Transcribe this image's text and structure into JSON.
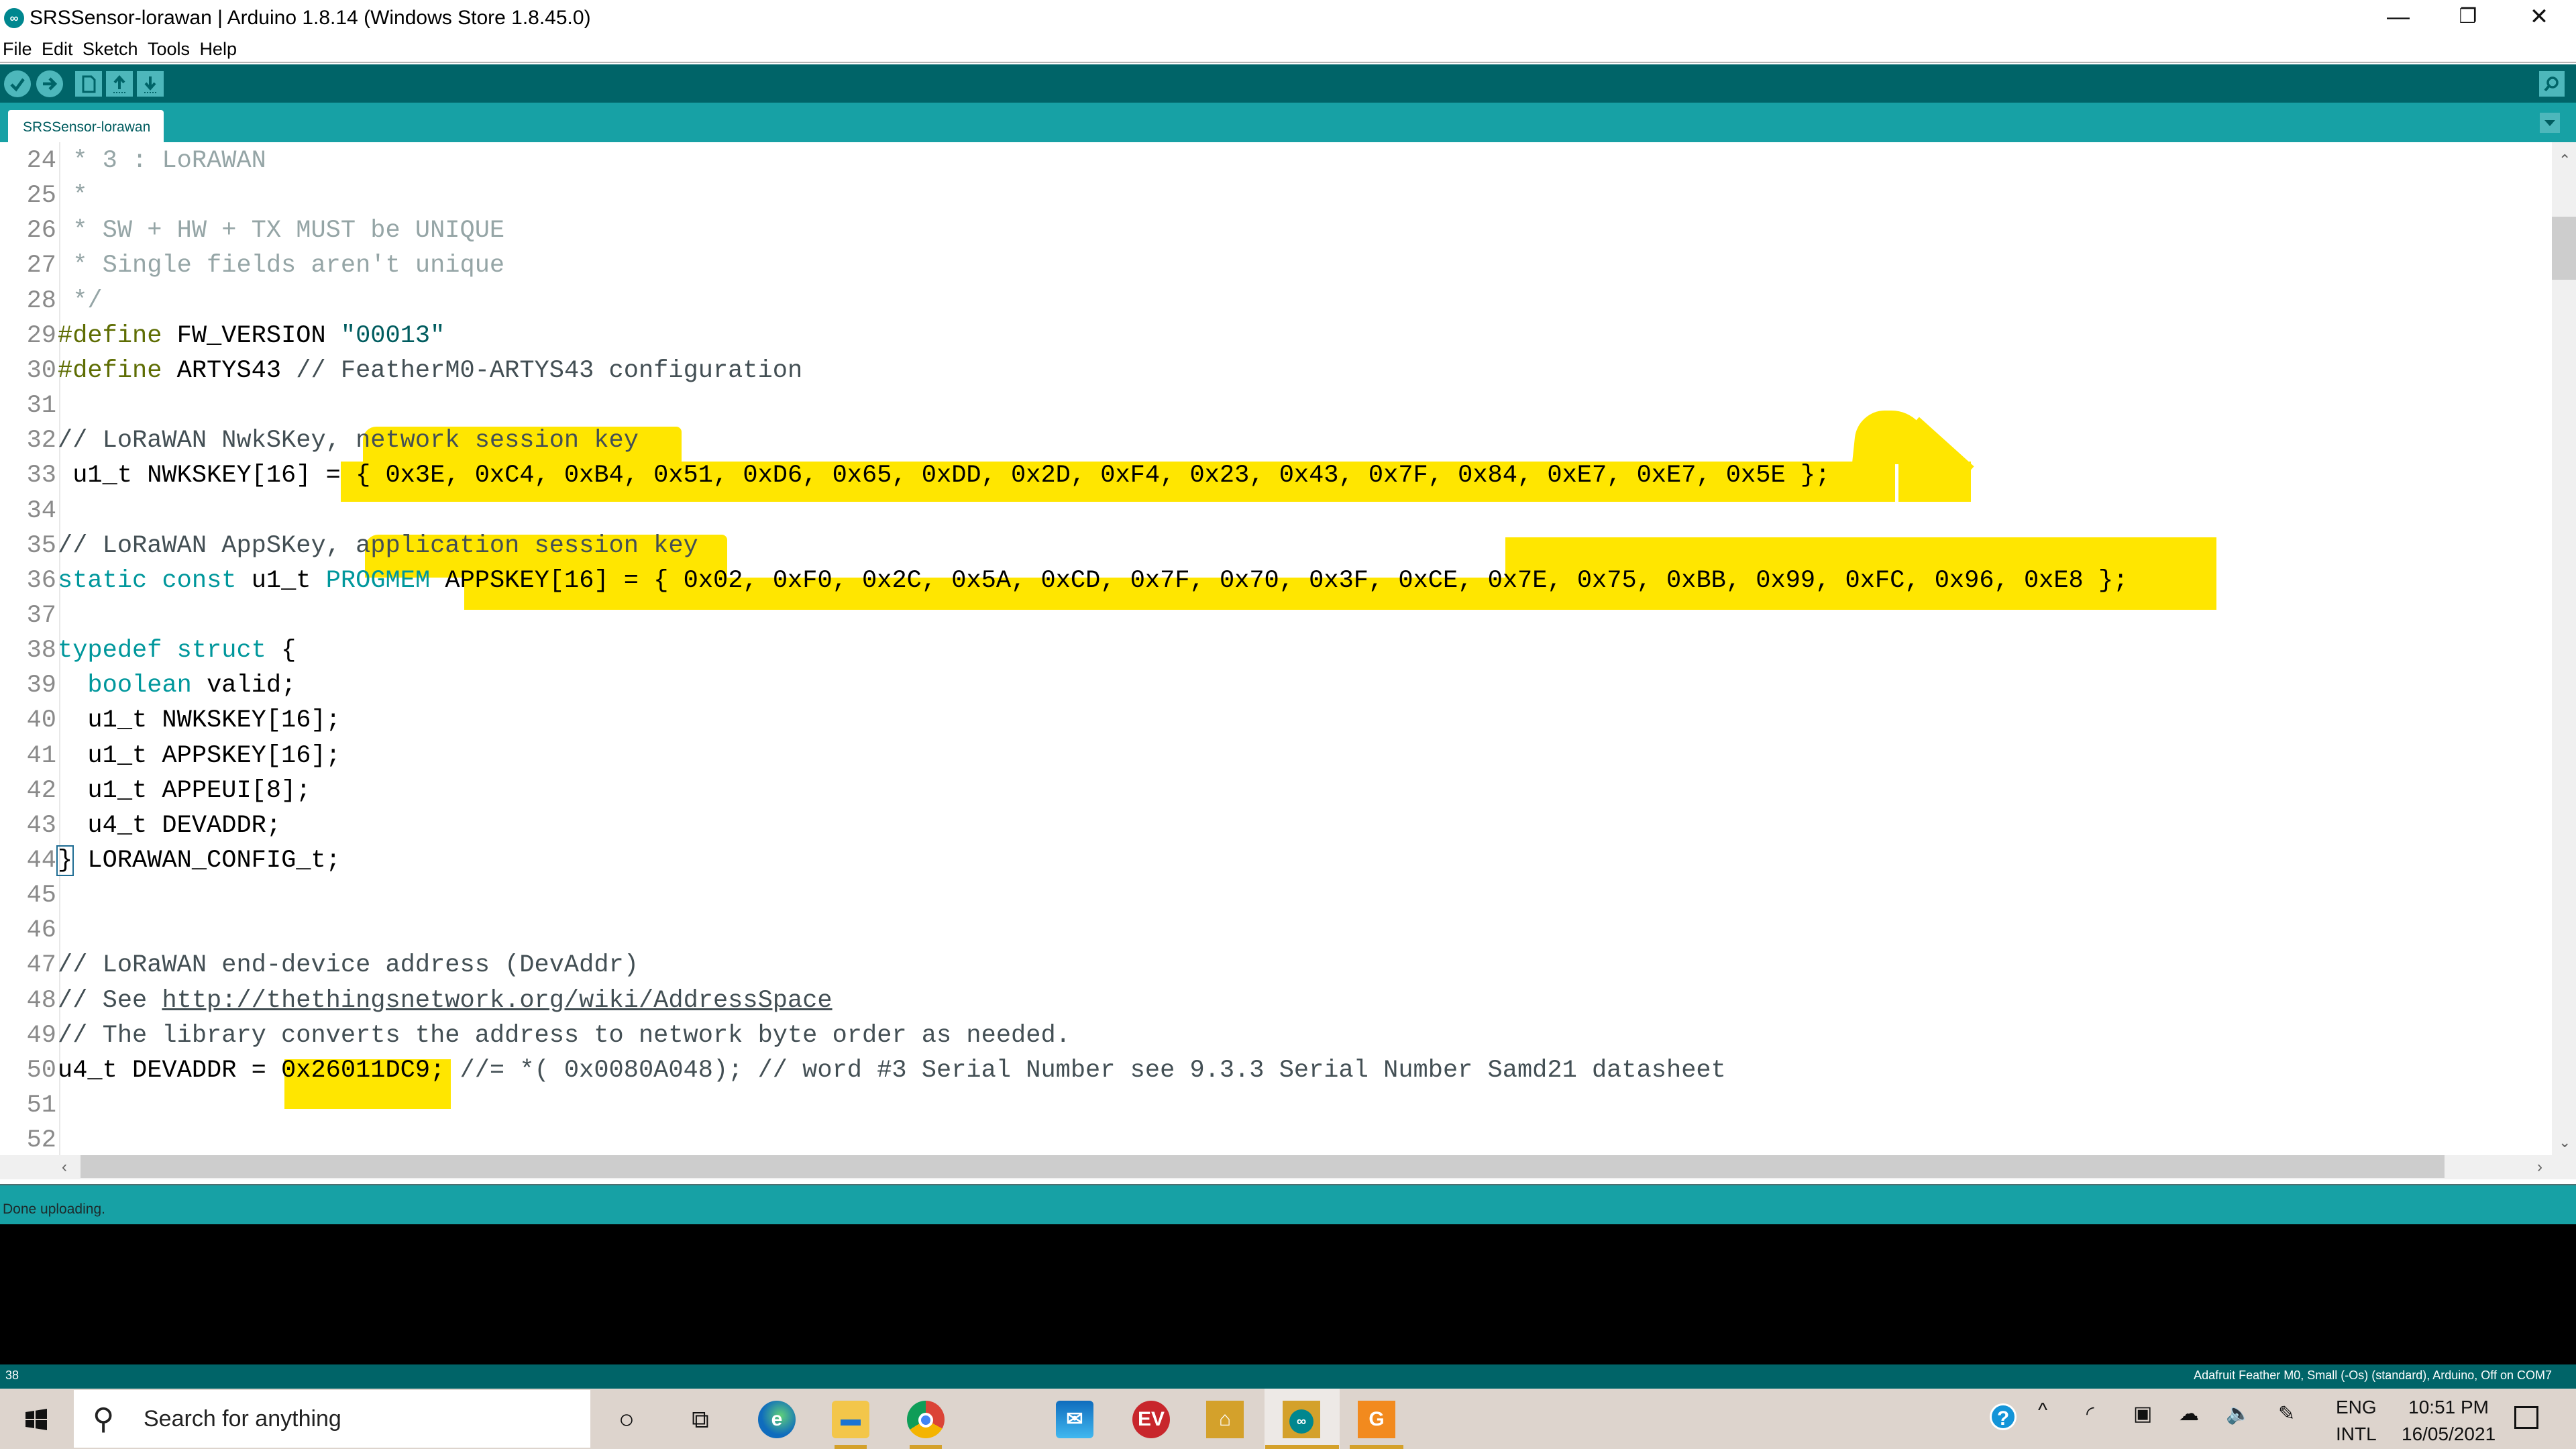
{
  "window": {
    "title": "SRSSensor-lorawan | Arduino 1.8.14 (Windows Store 1.8.45.0)",
    "controls": {
      "minimize": "—",
      "restore": "❐",
      "close": "✕"
    }
  },
  "menu": [
    "File",
    "Edit",
    "Sketch",
    "Tools",
    "Help"
  ],
  "toolbar": {
    "buttons": [
      "verify",
      "upload",
      "new",
      "open",
      "save"
    ],
    "serial_monitor": "serial-monitor"
  },
  "tabs": [
    {
      "label": "SRSSensor-lorawan",
      "active": true
    }
  ],
  "editor": {
    "lines": [
      {
        "n": "24",
        "segments": [
          {
            "t": " * 3 : LoRAWAN",
            "c": "c-com"
          }
        ]
      },
      {
        "n": "25",
        "segments": [
          {
            "t": " *",
            "c": "c-com"
          }
        ]
      },
      {
        "n": "26",
        "segments": [
          {
            "t": " * SW + HW + TX MUST be UNIQUE",
            "c": "c-com"
          }
        ]
      },
      {
        "n": "27",
        "segments": [
          {
            "t": " * Single fields aren't unique",
            "c": "c-com"
          }
        ]
      },
      {
        "n": "28",
        "segments": [
          {
            "t": " */",
            "c": "c-com"
          }
        ]
      },
      {
        "n": "29",
        "segments": [
          {
            "t": "#define",
            "c": "c-pre"
          },
          {
            "t": " FW_VERSION ",
            "c": ""
          },
          {
            "t": "\"00013\"",
            "c": "c-str"
          }
        ]
      },
      {
        "n": "30",
        "segments": [
          {
            "t": "#define",
            "c": "c-pre"
          },
          {
            "t": " ARTYS43 ",
            "c": ""
          },
          {
            "t": "// FeatherM0-ARTYS43 configuration",
            "c": "c-comd"
          }
        ]
      },
      {
        "n": "31",
        "segments": []
      },
      {
        "n": "32",
        "segments": [
          {
            "t": "// LoRaWAN NwkSKey, network session key",
            "c": "c-comd"
          }
        ]
      },
      {
        "n": "33",
        "segments": [
          {
            "t": " u1_t NWKSKEY[16] = { 0x3E, 0xC4, 0xB4, 0x51, 0xD6, 0x65, 0xDD, 0x2D, 0xF4, 0x23, 0x43, 0x7F, 0x84, 0xE7, 0xE7, 0x5E };",
            "c": ""
          }
        ]
      },
      {
        "n": "34",
        "segments": []
      },
      {
        "n": "35",
        "segments": [
          {
            "t": "// LoRaWAN AppSKey, application session key",
            "c": "c-comd"
          }
        ]
      },
      {
        "n": "36",
        "segments": [
          {
            "t": "static",
            "c": "c-kw"
          },
          {
            "t": " ",
            "c": ""
          },
          {
            "t": "const",
            "c": "c-kw"
          },
          {
            "t": " u1_t ",
            "c": ""
          },
          {
            "t": "PROGMEM",
            "c": "c-kw"
          },
          {
            "t": " APPSKEY[16] = { 0x02, 0xF0, 0x2C, 0x5A, 0xCD, 0x7F, 0x70, 0x3F, 0xCE, 0x7E, 0x75, 0xBB, 0x99, 0xFC, 0x96, 0xE8 };",
            "c": ""
          }
        ]
      },
      {
        "n": "37",
        "segments": []
      },
      {
        "n": "38",
        "segments": [
          {
            "t": "typedef",
            "c": "c-kw"
          },
          {
            "t": " ",
            "c": ""
          },
          {
            "t": "struct",
            "c": "c-kw"
          },
          {
            "t": " {",
            "c": ""
          }
        ]
      },
      {
        "n": "39",
        "segments": [
          {
            "t": "  ",
            "c": ""
          },
          {
            "t": "boolean",
            "c": "c-kw"
          },
          {
            "t": " valid;",
            "c": ""
          }
        ]
      },
      {
        "n": "40",
        "segments": [
          {
            "t": "  u1_t NWKSKEY[16];",
            "c": ""
          }
        ]
      },
      {
        "n": "41",
        "segments": [
          {
            "t": "  u1_t APPSKEY[16];",
            "c": ""
          }
        ]
      },
      {
        "n": "42",
        "segments": [
          {
            "t": "  u1_t APPEUI[8];",
            "c": ""
          }
        ]
      },
      {
        "n": "43",
        "segments": [
          {
            "t": "  u4_t DEVADDR;",
            "c": ""
          }
        ]
      },
      {
        "n": "44",
        "segments": [
          {
            "t": "}",
            "c": "brace-box"
          },
          {
            "t": " LORAWAN_CONFIG_t;",
            "c": ""
          }
        ]
      },
      {
        "n": "45",
        "segments": []
      },
      {
        "n": "46",
        "segments": []
      },
      {
        "n": "47",
        "segments": [
          {
            "t": "// LoRaWAN end-device address (DevAddr)",
            "c": "c-comd"
          }
        ]
      },
      {
        "n": "48",
        "segments": [
          {
            "t": "// See ",
            "c": "c-comd"
          },
          {
            "t": "http://thethingsnetwork.org/wiki/AddressSpace",
            "c": "c-link"
          }
        ]
      },
      {
        "n": "49",
        "segments": [
          {
            "t": "// The library converts the address to network byte order as needed.",
            "c": "c-comd"
          }
        ]
      },
      {
        "n": "50",
        "segments": [
          {
            "t": "u4_t DEVADDR = 0x26011DC9; ",
            "c": ""
          },
          {
            "t": "//= *( 0x0080A048); // word #3 Serial Number see 9.3.3 Serial Number Samd21 datasheet",
            "c": "c-comd"
          }
        ]
      },
      {
        "n": "51",
        "segments": []
      },
      {
        "n": "52",
        "segments": []
      }
    ],
    "highlight_color": "#ffe600"
  },
  "status": {
    "message": "Done uploading."
  },
  "boardbar": {
    "line_number": "38",
    "board": "Adafruit Feather M0, Small (-Os) (standard), Arduino, Off on COM7"
  },
  "taskbar": {
    "search_placeholder": "Search for anything",
    "apps": [
      "cortana",
      "task-view",
      "edge",
      "file-explorer",
      "chrome",
      "mail",
      "expressvpn",
      "app-house",
      "arduino",
      "foxit-pdf"
    ],
    "lang_top": "ENG",
    "lang_bottom": "INTL",
    "time": "10:51 PM",
    "date": "16/05/2021"
  },
  "colors": {
    "toolbar": "#006468",
    "tabbar": "#17a1a5",
    "accent": "#4db7bb",
    "highlight": "#ffe600"
  }
}
